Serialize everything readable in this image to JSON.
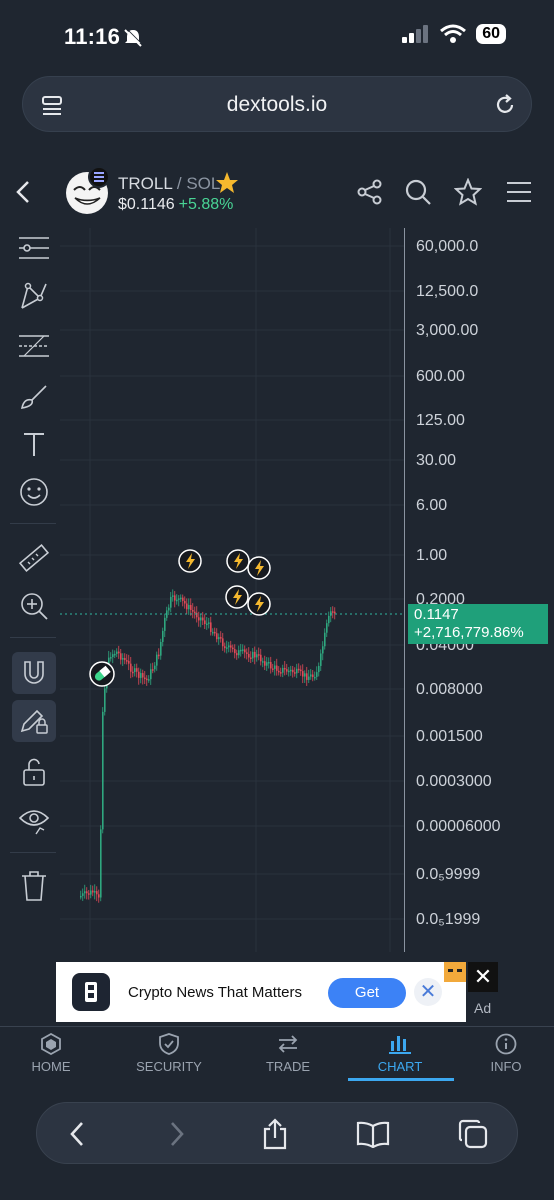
{
  "status": {
    "time": "11:16",
    "battery": "60"
  },
  "browser": {
    "url": "dextools.io"
  },
  "token": {
    "base": "TROLL",
    "separator": " / ",
    "quote": "SOL",
    "price": "$0.1146",
    "change": "+5.88%"
  },
  "chart": {
    "y_labels": [
      "60,000.0",
      "12,500.0",
      "3,000.00",
      "600.00",
      "125.00",
      "30.00",
      "6.00",
      "1.00",
      "0.2000",
      "0.04000",
      "0.008000",
      "0.001500",
      "0.0003000",
      "0.00006000",
      "0.0₅9999",
      "0.0₅1999"
    ],
    "price_tag": {
      "price": "0.1147",
      "change": "+2,716,779.86%"
    },
    "colors": {
      "up": "#2fa77f",
      "down": "#e04a57",
      "price_line": "#2fb6a0"
    }
  },
  "ad": {
    "text": "Crypto News That Matters",
    "button": "Get",
    "close": "✕",
    "label": "Ad"
  },
  "nav": {
    "items": [
      {
        "label": "HOME",
        "icon": "home-icon"
      },
      {
        "label": "SECURITY",
        "icon": "shield-icon"
      },
      {
        "label": "TRADE",
        "icon": "swap-icon"
      },
      {
        "label": "CHART",
        "icon": "chart-icon"
      },
      {
        "label": "INFO",
        "icon": "info-icon"
      }
    ],
    "active": "CHART"
  }
}
